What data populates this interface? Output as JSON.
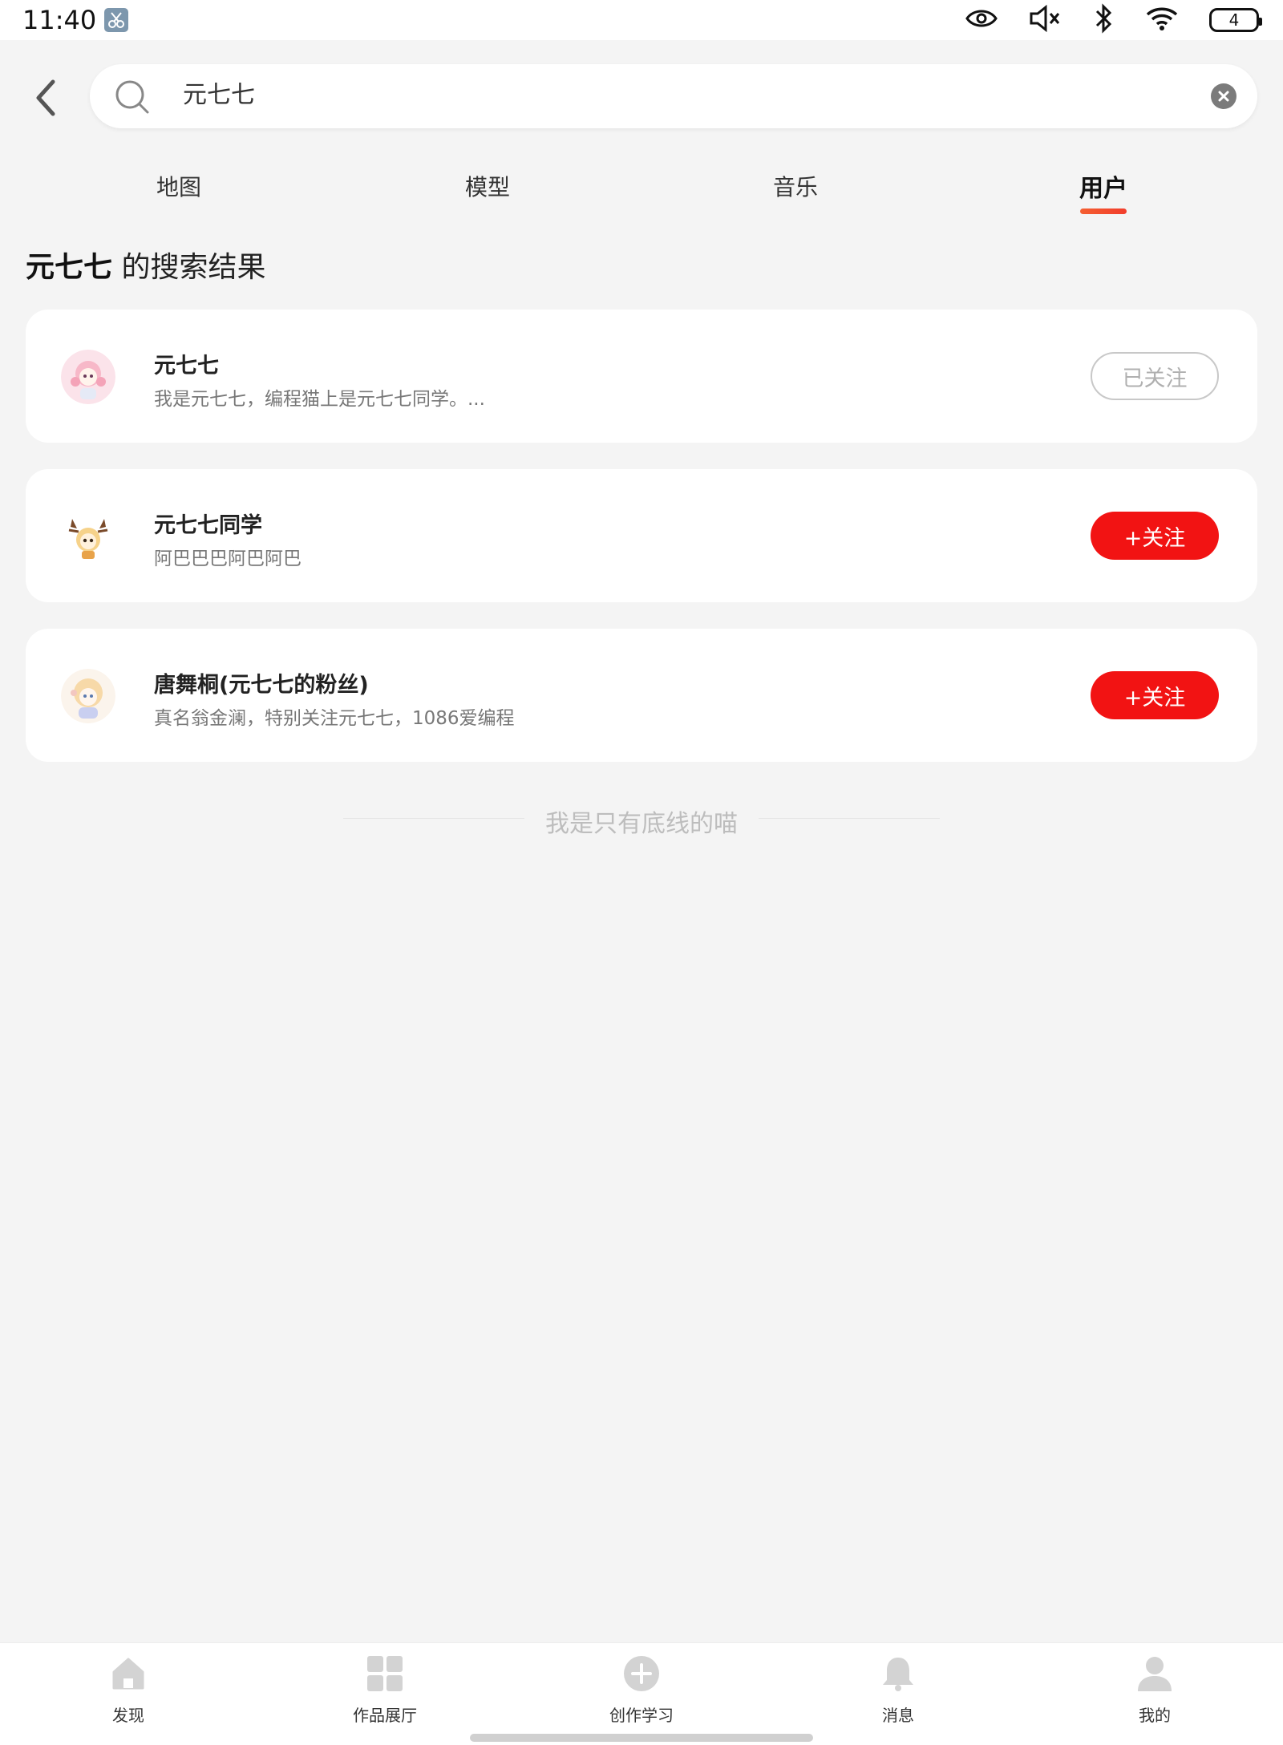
{
  "status_bar": {
    "time": "11:40",
    "battery_level": "4"
  },
  "search": {
    "query": "元七七"
  },
  "tabs": [
    {
      "label": "地图",
      "active": false
    },
    {
      "label": "模型",
      "active": false
    },
    {
      "label": "音乐",
      "active": false
    },
    {
      "label": "用户",
      "active": true
    }
  ],
  "results_heading": {
    "keyword": "元七七",
    "suffix": " 的搜索结果"
  },
  "users": [
    {
      "name": "元七七",
      "desc": "我是元七七，编程猫上是元七七同学。...",
      "follow_label": "已关注",
      "followed": true
    },
    {
      "name": "元七七同学",
      "desc": "阿巴巴巴阿巴阿巴",
      "follow_label": "+关注",
      "followed": false
    },
    {
      "name": "唐舞桐(元七七的粉丝)",
      "desc": "真名翁金澜，特别关注元七七，1086爱编程",
      "follow_label": "+关注",
      "followed": false
    }
  ],
  "end_text": "我是只有底线的喵",
  "bottom_nav": [
    {
      "label": "发现",
      "icon": "home-icon"
    },
    {
      "label": "作品展厅",
      "icon": "grid-icon"
    },
    {
      "label": "创作学习",
      "icon": "plus-circle-icon"
    },
    {
      "label": "消息",
      "icon": "bell-icon"
    },
    {
      "label": "我的",
      "icon": "person-icon"
    }
  ],
  "colors": {
    "accent": "#f21313",
    "tab_indicator": "#f45f31",
    "background": "#f4f4f4"
  }
}
